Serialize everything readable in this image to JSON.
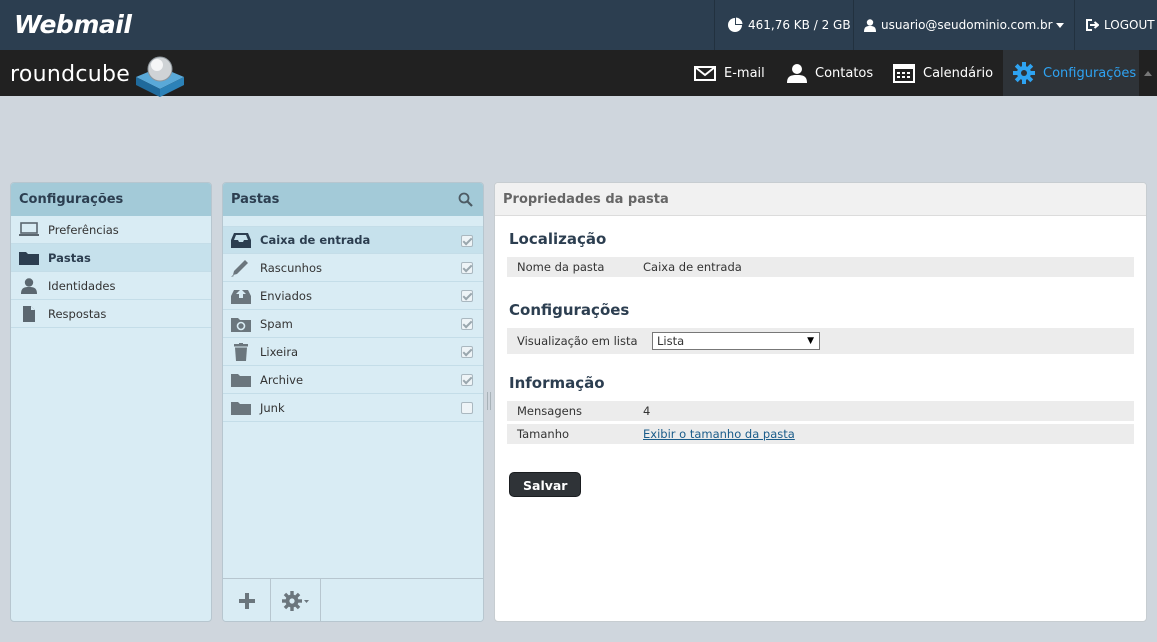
{
  "topbar": {
    "brand": "Webmail",
    "quota": "461,76 KB / 2 GB",
    "user": "usuario@seudominio.com.br",
    "logout": "LOGOUT"
  },
  "navbar": {
    "logo_text": "roundcube",
    "items": [
      {
        "label": "E-mail",
        "icon": "envelope-icon"
      },
      {
        "label": "Contatos",
        "icon": "person-icon"
      },
      {
        "label": "Calendário",
        "icon": "calendar-icon"
      },
      {
        "label": "Configurações",
        "icon": "gear-icon",
        "active": true
      }
    ]
  },
  "settings_panel": {
    "title": "Configurações",
    "items": [
      {
        "label": "Preferências",
        "icon": "monitor-icon"
      },
      {
        "label": "Pastas",
        "icon": "folder-icon",
        "selected": true
      },
      {
        "label": "Identidades",
        "icon": "person-icon"
      },
      {
        "label": "Respostas",
        "icon": "document-icon"
      }
    ]
  },
  "folders_panel": {
    "title": "Pastas",
    "folders": [
      {
        "label": "Caixa de entrada",
        "icon": "inbox-icon",
        "subscribed": true,
        "selected": true
      },
      {
        "label": "Rascunhos",
        "icon": "pencil-icon",
        "subscribed": true
      },
      {
        "label": "Enviados",
        "icon": "sent-icon",
        "subscribed": true
      },
      {
        "label": "Spam",
        "icon": "spam-icon",
        "subscribed": true
      },
      {
        "label": "Lixeira",
        "icon": "trash-icon",
        "subscribed": true
      },
      {
        "label": "Archive",
        "icon": "folder-icon",
        "subscribed": true
      },
      {
        "label": "Junk",
        "icon": "folder-icon",
        "subscribed": false
      }
    ]
  },
  "props_panel": {
    "title": "Propriedades da pasta",
    "location_title": "Localização",
    "folder_name_label": "Nome da pasta",
    "folder_name_value": "Caixa de entrada",
    "settings_title": "Configurações",
    "list_view_label": "Visualização em lista",
    "list_view_value": "Lista",
    "info_title": "Informação",
    "messages_label": "Mensagens",
    "messages_value": "4",
    "size_label": "Tamanho",
    "size_link": "Exibir o tamanho da pasta",
    "save_label": "Salvar"
  }
}
